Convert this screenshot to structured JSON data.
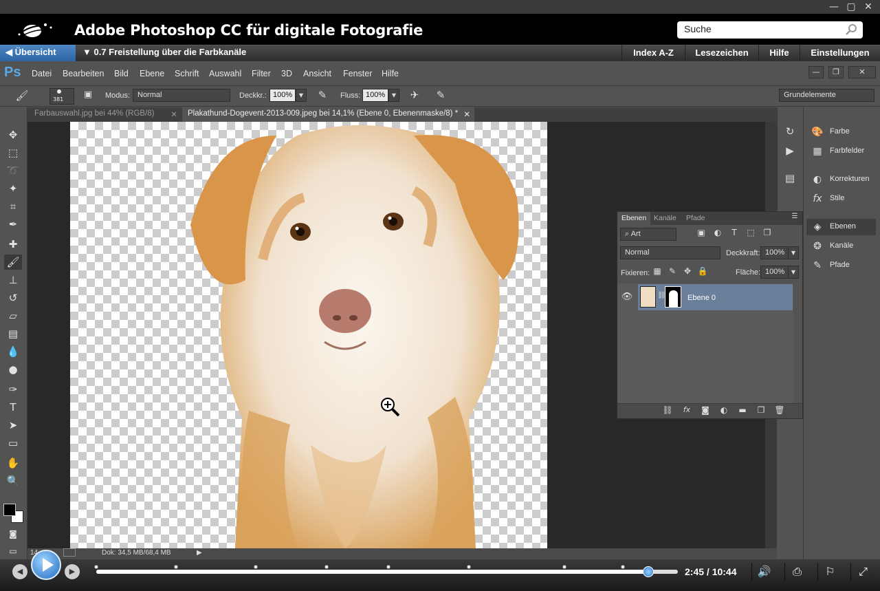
{
  "window": {
    "minimize": "—",
    "maximize": "▢",
    "close": "✕"
  },
  "header": {
    "title": "Adobe Photoshop CC für digitale Fotografie",
    "search_placeholder": "Suche"
  },
  "nav": {
    "back_label": "◀ Übersicht",
    "chapter": "▼ 0.7 Freistellung über die Farbkanäle",
    "links": [
      "Index A-Z",
      "Lesezeichen",
      "Hilfe",
      "Einstellungen"
    ]
  },
  "ps": {
    "logo": "Ps",
    "menu": [
      "Datei",
      "Bearbeiten",
      "Bild",
      "Ebene",
      "Schrift",
      "Auswahl",
      "Filter",
      "3D",
      "Ansicht",
      "Fenster",
      "Hilfe"
    ],
    "options": {
      "brush_size": "381",
      "mode_label": "Modus:",
      "mode_value": "Normal",
      "opacity_label": "Deckkr.:",
      "opacity_value": "100%",
      "flow_label": "Fluss:",
      "flow_value": "100%",
      "workspace": "Grundelemente"
    },
    "tabs": [
      {
        "label": "Farbauswahl.jpg bei 44% (RGB/8)",
        "active": false
      },
      {
        "label": "Plakathund-Dogevent-2013-009.jpeg bei 14,1% (Ebene 0, Ebenenmaske/8) *",
        "active": true
      }
    ],
    "status": {
      "zoom": "14",
      "doc": "Dok: 34,5 MB/68,4 MB"
    },
    "dock": [
      "Farbe",
      "Farbfelder",
      "Korrekturen",
      "Stile",
      "Ebenen",
      "Kanäle",
      "Pfade"
    ],
    "layers_panel": {
      "tabs": [
        "Ebenen",
        "Kanäle",
        "Pfade"
      ],
      "filter": "Art",
      "blend": "Normal",
      "opacity_label": "Deckkraft:",
      "opacity": "100%",
      "lock_label": "Fixieren:",
      "fill_label": "Fläche:",
      "fill": "100%",
      "layer_name": "Ebene 0"
    }
  },
  "player": {
    "time": "2:45 / 10:44",
    "progress": 0.95
  },
  "colors": {
    "accent": "#2d64a4",
    "layer_selected": "#6a7f9a"
  }
}
